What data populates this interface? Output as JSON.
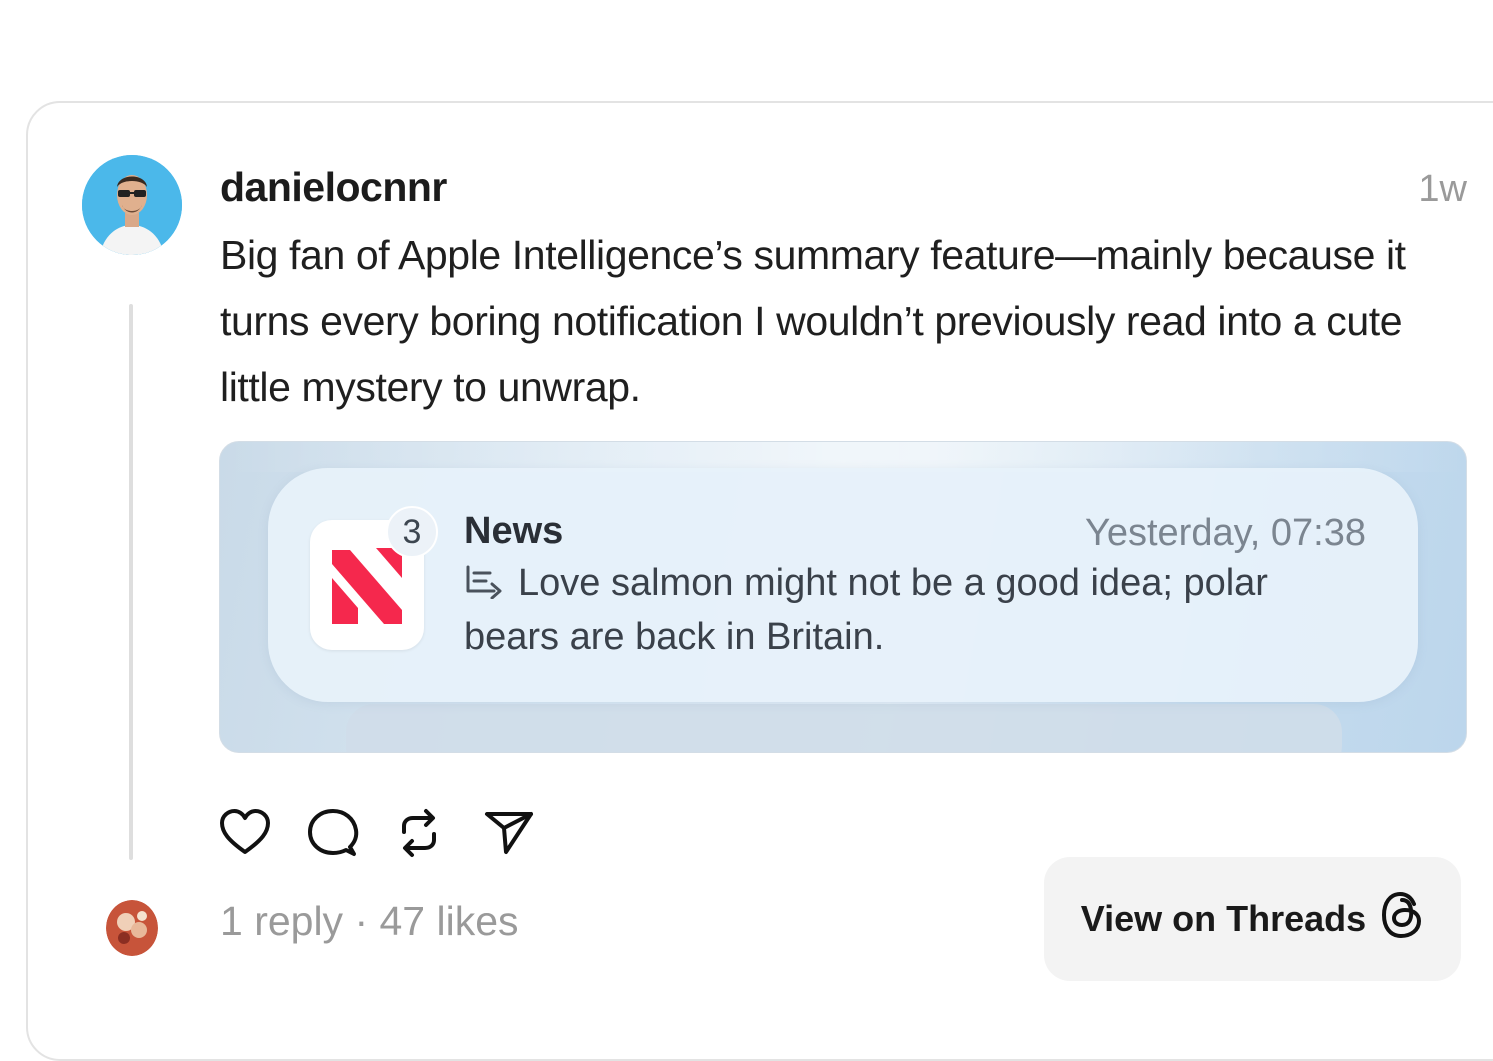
{
  "post": {
    "username": "danielocnnr",
    "time_ago": "1w",
    "text": "Big fan of Apple Intelligence’s summary feature—mainly because it turns every boring notification I wouldn’t previously read into a cute little mystery to unwrap."
  },
  "notification": {
    "badge_count": "3",
    "app_name": "News",
    "timestamp": "Yesterday, 07:38",
    "body": "Love salmon might not be a good idea; polar bears are back in Britain.",
    "icon": "apple-news-icon"
  },
  "actions": {
    "icons": [
      "heart-icon",
      "comment-icon",
      "repost-icon",
      "share-icon"
    ]
  },
  "footer": {
    "stats": "1 reply · 47 likes",
    "view_button_label": "View on Threads",
    "threads_icon": "threads-logo-icon"
  },
  "colors": {
    "news_red": "#f5284d",
    "avatar_bg": "#4bb8ea",
    "muted_text": "#9a9a9a"
  }
}
